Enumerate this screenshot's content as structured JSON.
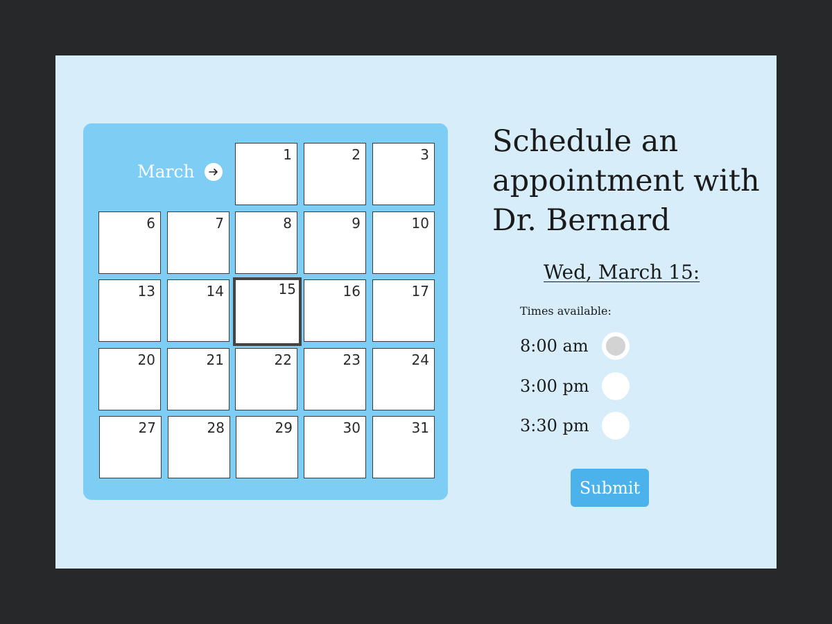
{
  "calendar": {
    "month": "March",
    "next_icon": "arrow-right-icon",
    "days": [
      "1",
      "2",
      "3",
      "6",
      "7",
      "8",
      "9",
      "10",
      "13",
      "14",
      "15",
      "16",
      "17",
      "20",
      "21",
      "22",
      "23",
      "24",
      "27",
      "28",
      "29",
      "30",
      "31"
    ],
    "selected_day": "15"
  },
  "booking": {
    "title_lines": [
      "Schedule an",
      "appointment with",
      "Dr. Bernard"
    ],
    "selected_date": "Wed, March 15:",
    "times_label": "Times available:",
    "times": [
      "8:00 am",
      "3:00 pm",
      "3:30 pm"
    ],
    "selected_time": "8:00 am",
    "submit_label": "Submit"
  },
  "colors": {
    "background": "#27282a",
    "panel": "#d8edfa",
    "calendar": "#7ecdf5",
    "submit": "#4bb2ec",
    "radio_selected": "#d3d3d3"
  }
}
